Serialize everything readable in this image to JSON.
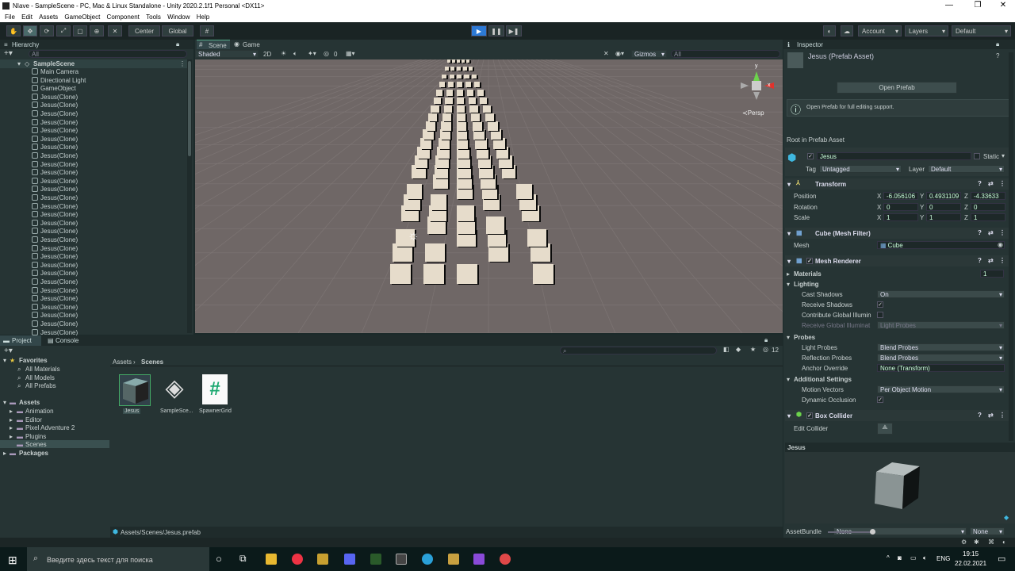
{
  "window": {
    "title": "NIave - SampleScene - PC, Mac & Linux Standalone - Unity 2020.2.1f1 Personal <DX11>",
    "min": "—",
    "max": "❐",
    "close": "✕"
  },
  "menu": [
    "File",
    "Edit",
    "Assets",
    "GameObject",
    "Component",
    "Tools",
    "Window",
    "Help"
  ],
  "toolbar": {
    "center": "Center",
    "global": "Global",
    "account": "Account",
    "layers": "Layers",
    "layout": "Default"
  },
  "hierarchy": {
    "title": "Hierarchy",
    "search": "All",
    "scene": "SampleScene",
    "items": [
      "Main Camera",
      "Directional Light",
      "GameObject",
      "Jesus(Clone)",
      "Jesus(Clone)",
      "Jesus(Clone)",
      "Jesus(Clone)",
      "Jesus(Clone)",
      "Jesus(Clone)",
      "Jesus(Clone)",
      "Jesus(Clone)",
      "Jesus(Clone)",
      "Jesus(Clone)",
      "Jesus(Clone)",
      "Jesus(Clone)",
      "Jesus(Clone)",
      "Jesus(Clone)",
      "Jesus(Clone)",
      "Jesus(Clone)",
      "Jesus(Clone)",
      "Jesus(Clone)",
      "Jesus(Clone)",
      "Jesus(Clone)",
      "Jesus(Clone)",
      "Jesus(Clone)",
      "Jesus(Clone)",
      "Jesus(Clone)",
      "Jesus(Clone)",
      "Jesus(Clone)",
      "Jesus(Clone)",
      "Jesus(Clone)",
      "Jesus(Clone)"
    ]
  },
  "scene": {
    "tab_scene": "Scene",
    "tab_game": "Game",
    "shading": "Shaded",
    "mode2d": "2D",
    "fx": "0",
    "gizmos": "Gizmos",
    "search": "All",
    "persp": "≺Persp",
    "axis_y": "y",
    "axis_x": "x"
  },
  "inspector": {
    "title": "Inspector",
    "asset_name": "Jesus (Prefab Asset)",
    "open_prefab": "Open Prefab",
    "info": "Open Prefab for full editing support.",
    "root_label": "Root in Prefab Asset",
    "obj_name": "Jesus",
    "static": "Static",
    "tag_label": "Tag",
    "tag": "Untagged",
    "layer_label": "Layer",
    "layer": "Default",
    "transform": {
      "title": "Transform",
      "position": {
        "label": "Position",
        "x": "-6.056106",
        "y": "0.4931109",
        "z": "-4.33633"
      },
      "rotation": {
        "label": "Rotation",
        "x": "0",
        "y": "0",
        "z": "0"
      },
      "scale": {
        "label": "Scale",
        "x": "1",
        "y": "1",
        "z": "1"
      }
    },
    "mesh_filter": {
      "title": "Cube (Mesh Filter)",
      "mesh_label": "Mesh",
      "mesh": "Cube"
    },
    "mesh_renderer": {
      "title": "Mesh Renderer",
      "materials": "Materials",
      "materials_count": "1",
      "lighting": "Lighting",
      "cast_shadows": "Cast Shadows",
      "cast_value": "On",
      "receive_shadows": "Receive Shadows",
      "contribute_gi": "Contribute Global Illumin",
      "receive_gi": "Receive Global Illuminat",
      "receive_gi_value": "Light Probes",
      "probes": "Probes",
      "light_probes": "Light Probes",
      "light_probes_value": "Blend Probes",
      "reflection_probes": "Reflection Probes",
      "reflection_value": "Blend Probes",
      "anchor": "Anchor Override",
      "anchor_value": "None (Transform)",
      "additional": "Additional Settings",
      "motion": "Motion Vectors",
      "motion_value": "Per Object Motion",
      "dynamic": "Dynamic Occlusion"
    },
    "box_collider": {
      "title": "Box Collider",
      "edit": "Edit Collider"
    },
    "preview_label": "Jesus",
    "assetbundle": "AssetBundle",
    "ab_value": "None",
    "ab_variant": "None"
  },
  "project": {
    "tab_project": "Project",
    "tab_console": "Console",
    "count": "12",
    "favorites": "Favorites",
    "fav_items": [
      "All Materials",
      "All Models",
      "All Prefabs"
    ],
    "assets": "Assets",
    "asset_folders": [
      "Animation",
      "Editor",
      "Pixel Adventure 2",
      "Plugins",
      "Scenes"
    ],
    "packages": "Packages",
    "breadcrumb": [
      "Assets",
      "Scenes"
    ],
    "files": [
      "Jesus",
      "SampleSce...",
      "SpawnerGrid"
    ],
    "path": "Assets/Scenes/Jesus.prefab"
  },
  "taskbar": {
    "search": "Введите здесь текст для поиска",
    "lang": "ENG",
    "time": "19:15",
    "date": "22.02.2021"
  }
}
